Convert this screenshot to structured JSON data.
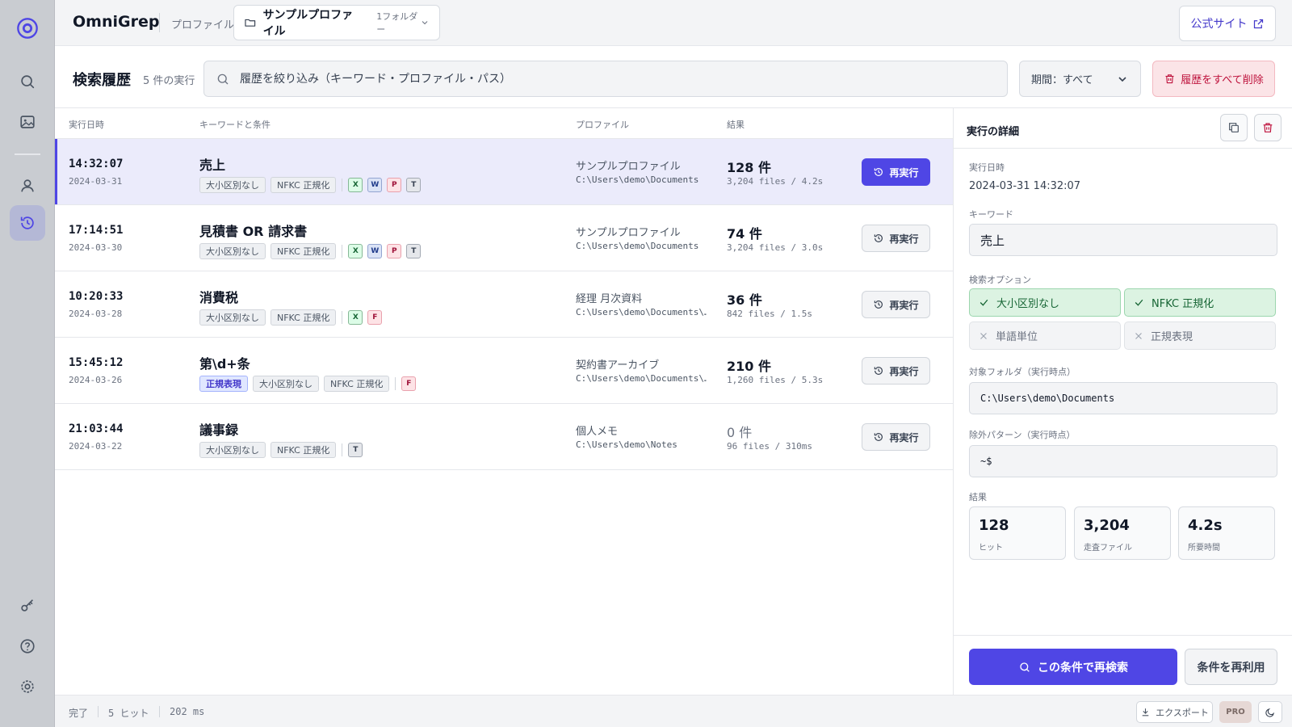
{
  "app": {
    "brand": "OmniGrep"
  },
  "topbar": {
    "profile_label": "プロファイル:",
    "profile_name": "サンプルプロファイル",
    "profile_folders": "1フォルダー",
    "site_button": "公式サイト"
  },
  "history": {
    "title": "検索履歴",
    "count": "5 件の実行",
    "filter_placeholder": "履歴を絞り込み（キーワード・プロファイル・パス）",
    "period": "期間：すべて",
    "clear_all": "履歴をすべて削除",
    "columns": {
      "datetime": "実行日時",
      "keyword": "キーワードと条件",
      "profile": "プロファイル",
      "result": "結果"
    },
    "rerun_label": "再実行",
    "rows": [
      {
        "time": "14:32:07",
        "date": "2024-03-31",
        "keyword": "売上",
        "tags": [
          "大小区別なし",
          "NFKC 正規化"
        ],
        "filetypes": [
          "X",
          "W",
          "P",
          "T"
        ],
        "profile": "サンプルプロファイル",
        "path": "C:\\Users\\demo\\Documents",
        "hits": "128 件",
        "meta": "3,204 files / 4.2s",
        "selected": true
      },
      {
        "time": "17:14:51",
        "date": "2024-03-30",
        "keyword": "見積書 OR 請求書",
        "tags": [
          "大小区別なし",
          "NFKC 正規化"
        ],
        "filetypes": [
          "X",
          "W",
          "P",
          "T"
        ],
        "profile": "サンプルプロファイル",
        "path": "C:\\Users\\demo\\Documents",
        "hits": "74 件",
        "meta": "3,204 files / 3.0s",
        "selected": false
      },
      {
        "time": "10:20:33",
        "date": "2024-03-28",
        "keyword": "消費税",
        "tags": [
          "大小区別なし",
          "NFKC 正規化"
        ],
        "filetypes": [
          "X",
          "F"
        ],
        "profile": "経理 月次資料",
        "path": "C:\\Users\\demo\\Documents\\…",
        "hits": "36 件",
        "meta": "842 files / 1.5s",
        "selected": false
      },
      {
        "time": "15:45:12",
        "date": "2024-03-26",
        "keyword": "第\\d+条",
        "regex_tag": "正規表現",
        "tags": [
          "大小区別なし",
          "NFKC 正規化"
        ],
        "filetypes": [
          "F"
        ],
        "profile": "契約書アーカイブ",
        "path": "C:\\Users\\demo\\Documents\\…",
        "hits": "210 件",
        "meta": "1,260 files / 5.3s",
        "selected": false
      },
      {
        "time": "21:03:44",
        "date": "2024-03-22",
        "keyword": "議事録",
        "tags": [
          "大小区別なし",
          "NFKC 正規化"
        ],
        "filetypes": [
          "T"
        ],
        "profile": "個人メモ",
        "path": "C:\\Users\\demo\\Notes",
        "hits": "0 件",
        "meta": "96 files / 310ms",
        "selected": false
      }
    ]
  },
  "detail": {
    "title": "実行の詳細",
    "datetime_label": "実行日時",
    "datetime": "2024-03-31 14:32:07",
    "keyword_label": "キーワード",
    "keyword": "売上",
    "options_label": "検索オプション",
    "options": [
      {
        "label": "大小区別なし",
        "on": true
      },
      {
        "label": "NFKC 正規化",
        "on": true
      },
      {
        "label": "単語単位",
        "on": false
      },
      {
        "label": "正規表現",
        "on": false
      }
    ],
    "folder_label": "対象フォルダ（実行時点）",
    "folder": "C:\\Users\\demo\\Documents",
    "exclude_label": "除外パターン（実行時点）",
    "exclude": "~$",
    "result_label": "結果",
    "stats": [
      {
        "value": "128",
        "label": "ヒット"
      },
      {
        "value": "3,204",
        "label": "走査ファイル"
      },
      {
        "value": "4.2s",
        "label": "所要時間"
      }
    ],
    "research_button": "この条件で再検索",
    "reuse_button": "条件を再利用"
  },
  "status": {
    "state": "完了",
    "hits": "5 ヒット",
    "time": "202 ms",
    "export": "エクスポート",
    "pro": "PRO"
  },
  "colors": {
    "accent": "#4f46e5",
    "danger": "#be123c",
    "success": "#166534"
  }
}
